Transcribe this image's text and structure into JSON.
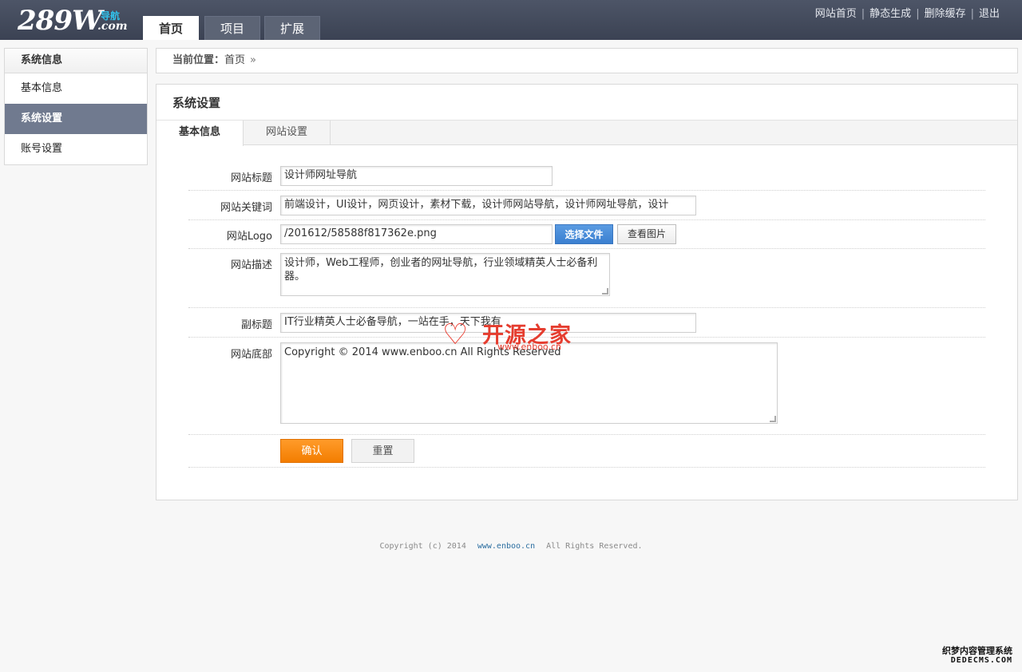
{
  "header": {
    "logo_main": "289W",
    "logo_sub_cn": "导航",
    "logo_sub_en": ".com",
    "nav_tabs": [
      {
        "label": "首页",
        "active": true
      },
      {
        "label": "项目",
        "active": false
      },
      {
        "label": "扩展",
        "active": false
      }
    ],
    "top_links": [
      "网站首页",
      "静态生成",
      "删除缓存",
      "退出"
    ]
  },
  "sidebar": {
    "heading": "系统信息",
    "items": [
      {
        "label": "基本信息",
        "active": false
      },
      {
        "label": "系统设置",
        "active": true
      },
      {
        "label": "账号设置",
        "active": false
      }
    ]
  },
  "breadcrumb": {
    "label": "当前位置：",
    "path": "首页",
    "separator": "»"
  },
  "panel": {
    "title": "系统设置",
    "tabs": [
      {
        "label": "基本信息",
        "active": true
      },
      {
        "label": "网站设置",
        "active": false
      }
    ]
  },
  "form": {
    "site_title": {
      "label": "网站标题",
      "value": "设计师网址导航"
    },
    "keywords": {
      "label": "网站关键词",
      "value": "前端设计，UI设计，网页设计，素材下载，设计师网站导航，设计师网址导航，设计"
    },
    "logo": {
      "label": "网站Logo",
      "value": "/201612/58588f817362e.png",
      "choose_file": "选择文件",
      "view_image": "查看图片"
    },
    "description": {
      "label": "网站描述",
      "value": "设计师，Web工程师，创业者的网址导航，行业领域精英人士必备利器。"
    },
    "subtitle": {
      "label": "副标题",
      "value": "IT行业精英人士必备导航，一站在手，天下我有"
    },
    "footer_text": {
      "label": "网站底部",
      "value": "Copyright © 2014 www.enboo.cn All Rights Reserved"
    },
    "submit_label": "确认",
    "reset_label": "重置"
  },
  "footer": {
    "prefix": "Copyright (c) 2014",
    "domain": "www.enboo.cn",
    "suffix": "All Rights Reserved."
  },
  "watermark": {
    "text": "开源之家",
    "url": "www.enboo.cn"
  },
  "corner_mark": {
    "cn": "织梦内容管理系统",
    "en": "DEDECMS.COM"
  },
  "colors": {
    "header_bg": "#434a5b",
    "sidebar_active": "#707a8f",
    "primary_button": "#f37d00",
    "file_button": "#3a7fd0",
    "footer_link": "#2b6ea0"
  }
}
